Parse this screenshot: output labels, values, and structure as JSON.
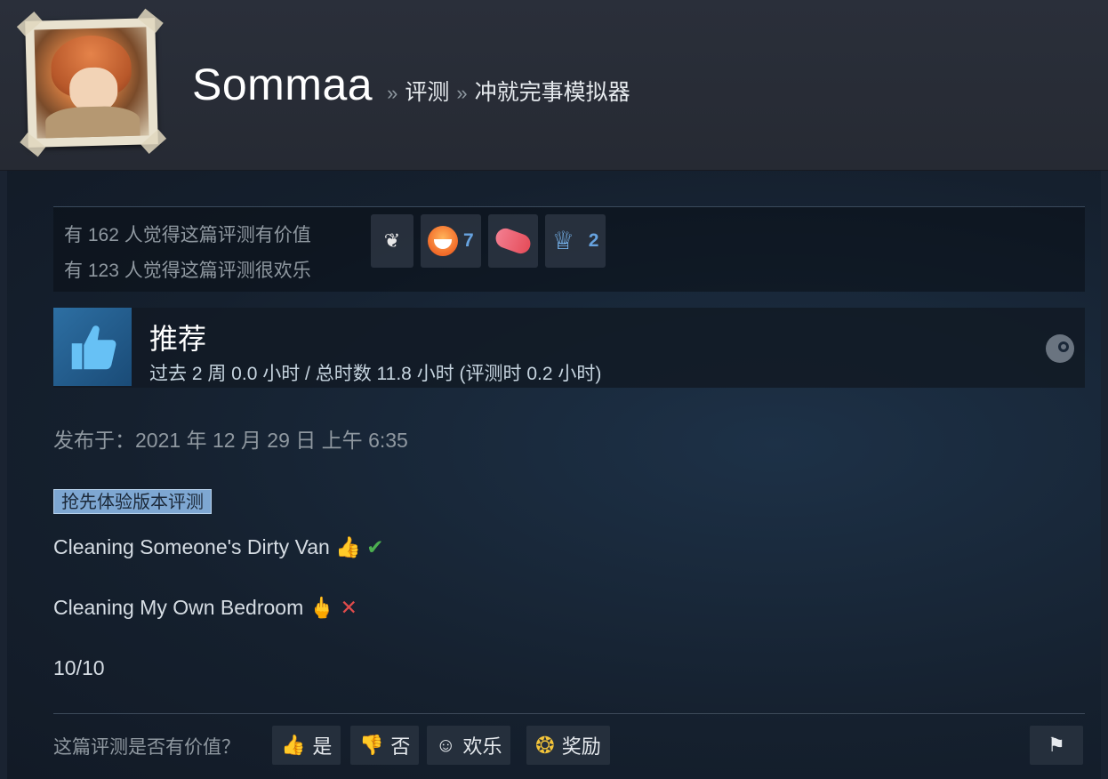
{
  "header": {
    "username": "Sommaa",
    "breadcrumb_sep_1": "»",
    "breadcrumb_reviews": "评测",
    "breadcrumb_sep_2": "»",
    "breadcrumb_game": "冲就完事模拟器"
  },
  "votes": {
    "helpful_line": "有 162 人觉得这篇评测有价值",
    "funny_line": "有 123 人觉得这篇评测很欢乐",
    "awards": [
      {
        "icon": "wings-award-icon",
        "count": ""
      },
      {
        "icon": "laughing-face-award-icon",
        "count": "7"
      },
      {
        "icon": "pill-award-icon",
        "count": ""
      },
      {
        "icon": "ribbon-award-icon",
        "count": "2"
      }
    ]
  },
  "recommendation": {
    "title": "推荐",
    "hours": "过去 2 周 0.0 小时 / 总时数 11.8 小时   (评测时 0.2 小时)"
  },
  "posted": "发布于：2021 年 12 月 29 日 上午 6:35",
  "review": {
    "early_access_tag": "抢先体验版本评测",
    "line1_text": "Cleaning Someone's Dirty Van",
    "line1_emoji_a": "👍",
    "line1_emoji_b": "✔",
    "line2_text": "Cleaning My Own Bedroom",
    "line2_emoji_a": "🖕",
    "line2_emoji_b": "✕",
    "line3_text": "10/10"
  },
  "footer": {
    "question": "这篇评测是否有价值？",
    "yes_label": "是",
    "no_label": "否",
    "funny_label": "欢乐",
    "award_label": "奖励"
  },
  "colors": {
    "background": "#1b2838",
    "header": "#2a2f3a",
    "accent_blue": "#67a3e0",
    "tag": "#7ea7d2"
  }
}
